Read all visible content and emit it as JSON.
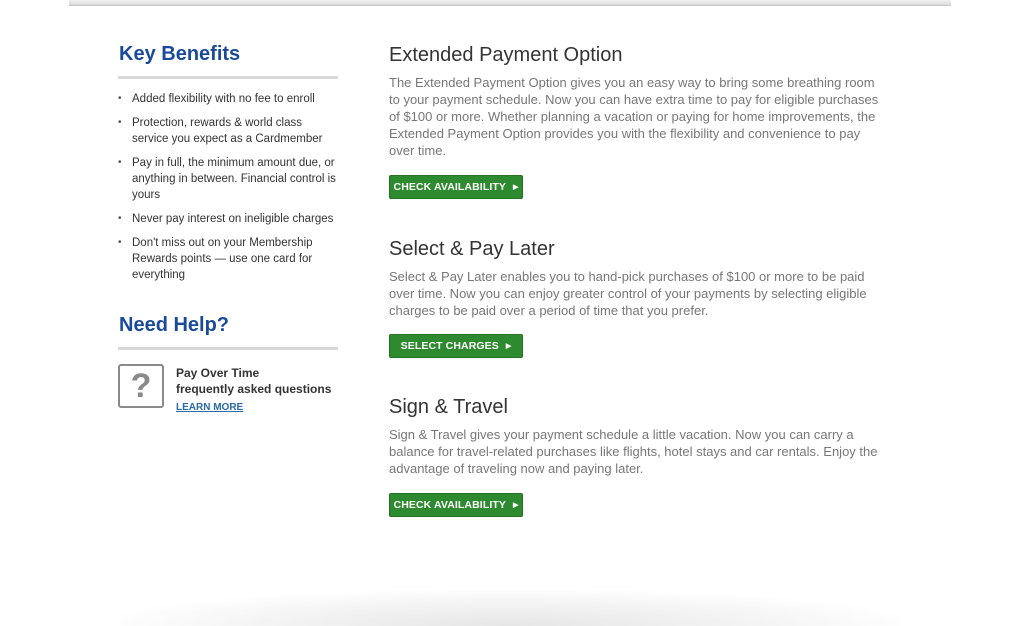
{
  "sidebar": {
    "key_benefits": {
      "heading": "Key Benefits",
      "items": [
        "Added flexibility with no fee to enroll",
        "Protection, rewards & world class service you expect as a Cardmember",
        "Pay in full, the minimum amount due, or anything in between. Financial control is yours",
        "Never pay interest on ineligible charges",
        "Don't miss out on your Membership Rewards points — use one card for everything"
      ]
    },
    "need_help": {
      "heading": "Need Help?",
      "icon": "question-mark-icon",
      "title_line1": "Pay Over Time",
      "title_line2": "frequently asked questions",
      "link": "LEARN MORE"
    }
  },
  "main": {
    "sections": [
      {
        "title": "Extended Payment Option",
        "description": "The Extended Payment Option gives you an easy way to bring some breathing room to your payment schedule. Now you can have extra time to pay for eligible purchases of $100 or more. Whether planning a vacation or paying for home improvements, the Extended Payment Option provides you with the flexibility and convenience to pay over time.",
        "button": "CHECK AVAILABILITY"
      },
      {
        "title": "Select & Pay Later",
        "description": "Select & Pay Later enables you to hand-pick purchases of $100 or more to be paid over time. Now you can enjoy greater control of your payments by selecting eligible charges to be paid over a period of time that you prefer.",
        "button": "SELECT CHARGES"
      },
      {
        "title": "Sign & Travel",
        "description": "Sign & Travel gives your payment schedule a little vacation. Now you can carry a balance for travel-related purchases like flights, hotel stays and car rentals. Enjoy the advantage of traveling now and paying later.",
        "button": "CHECK AVAILABILITY"
      }
    ]
  },
  "colors": {
    "heading_blue": "#1a4a9a",
    "button_green": "#2e8a2e",
    "link_blue": "#2a6aa6"
  }
}
